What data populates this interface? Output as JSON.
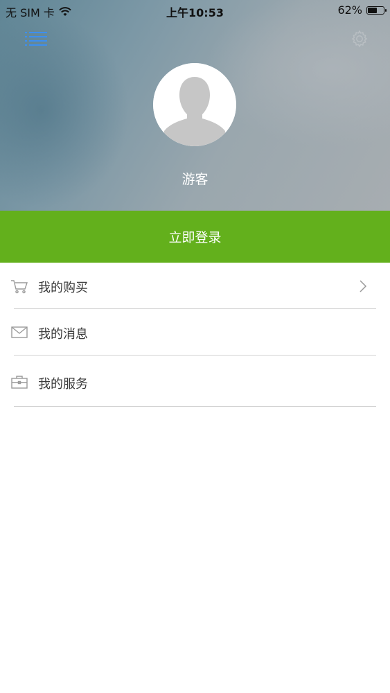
{
  "status_bar": {
    "carrier": "无 SIM 卡",
    "time": "上午10:53",
    "battery_percent_label": "62%",
    "battery_level": 0.62
  },
  "header": {
    "menu_icon": "list-menu-icon",
    "settings_icon": "gear-icon",
    "avatar_icon": "default-avatar-icon",
    "user_name": "游客"
  },
  "login": {
    "label": "立即登录",
    "color": "#63b01c"
  },
  "menu": {
    "items": [
      {
        "label": "我的购买",
        "icon": "cart-icon",
        "has_chevron": true
      },
      {
        "label": "我的消息",
        "icon": "envelope-icon",
        "has_chevron": false
      },
      {
        "label": "我的服务",
        "icon": "briefcase-icon",
        "has_chevron": false
      }
    ]
  },
  "colors": {
    "accent": "#63b01c",
    "menu_icon_blue": "#3d8ff0",
    "divider": "#d2d2d2"
  }
}
